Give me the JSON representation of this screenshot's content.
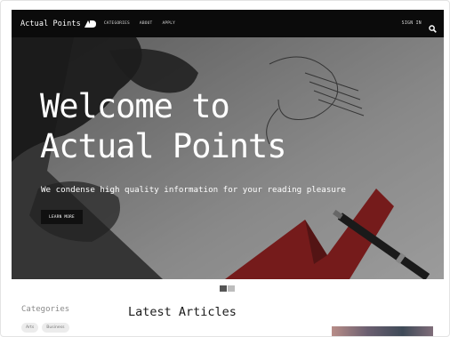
{
  "brand": {
    "name": "Actual Points"
  },
  "nav": {
    "links": [
      "CATEGORIES",
      "ABOUT",
      "APPLY"
    ],
    "signin": "SIGN IN",
    "search_icon": "search-icon"
  },
  "hero": {
    "title": "Welcome to Actual Points",
    "subtitle": "We condense high quality information for your reading pleasure",
    "button": "LEARN MORE"
  },
  "carousel": {
    "slides": 2,
    "active": 1
  },
  "categories": {
    "heading": "Categories",
    "tags": [
      "Arts",
      "Business"
    ]
  },
  "articles": {
    "heading": "Latest Articles"
  },
  "colors": {
    "navbar": "#0b0b0b",
    "hero_overlay": "#141414",
    "button": "#101010",
    "tag_bg": "#ececec"
  }
}
